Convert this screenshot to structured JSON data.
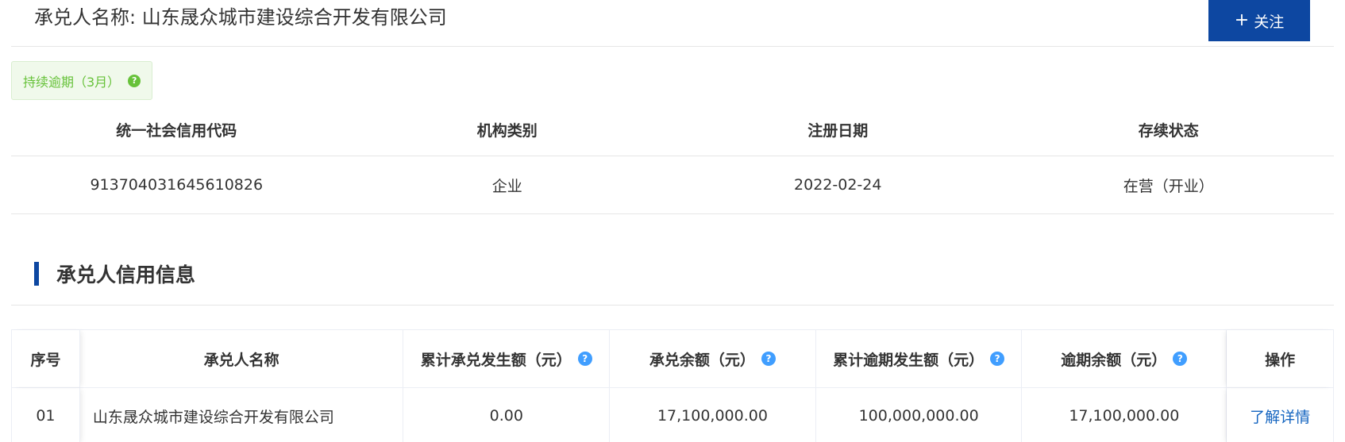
{
  "header": {
    "title": "承兑人名称: 山东晟众城市建设综合开发有限公司",
    "follow_button": {
      "icon": "plus-icon",
      "plus_glyph": "+",
      "label": "关注"
    }
  },
  "status_tag": {
    "label": "持续逾期（3月）",
    "help_icon": "question-circle-icon",
    "help_glyph": "?"
  },
  "company_info": {
    "headers": [
      "统一社会信用代码",
      "机构类别",
      "注册日期",
      "存续状态"
    ],
    "values": [
      "913704031645610826",
      "企业",
      "2022-02-24",
      "在营（开业）"
    ]
  },
  "section": {
    "title": "承兑人信用信息"
  },
  "credit_table": {
    "help_glyph": "?",
    "columns": [
      {
        "label": "序号",
        "help": false
      },
      {
        "label": "承兑人名称",
        "help": false
      },
      {
        "label": "累计承兑发生额（元）",
        "help": true
      },
      {
        "label": "承兑余额（元）",
        "help": true
      },
      {
        "label": "累计逾期发生额（元）",
        "help": true
      },
      {
        "label": "逾期余额（元）",
        "help": true
      },
      {
        "label": "操作",
        "help": false
      }
    ],
    "rows": [
      {
        "index": "01",
        "name": "山东晟众城市建设综合开发有限公司",
        "cumulative_acceptance": "0.00",
        "acceptance_balance": "17,100,000.00",
        "cumulative_overdue": "100,000,000.00",
        "overdue_balance": "17,100,000.00",
        "action": "了解详情"
      }
    ]
  },
  "colors": {
    "primary": "#0d47a1",
    "tag_green": "#67c23a",
    "help_blue": "#409eff",
    "link_blue": "#1565c0"
  }
}
